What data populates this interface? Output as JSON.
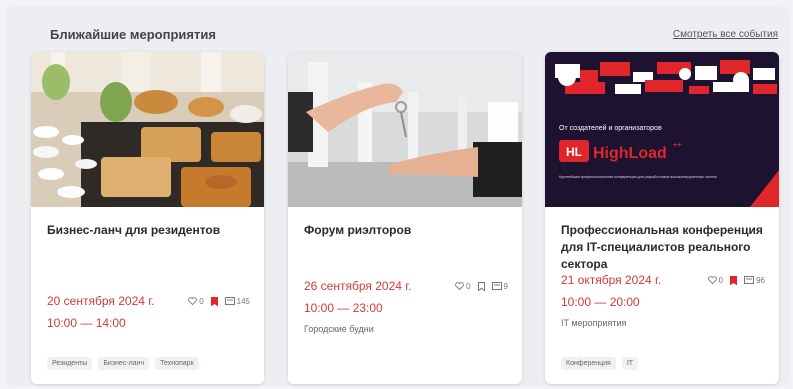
{
  "section": {
    "title": "Ближайшие мероприятия",
    "all_events_link": "Смотреть все события"
  },
  "banner": {
    "caption": "От создателей и организаторов",
    "logo_abbr": "HL",
    "logo_name": "HighLoad",
    "logo_sup": "++",
    "subcaption": "Крупнейшая профессиональная конференция для разработчиков высоконагруженных систем"
  },
  "events": [
    {
      "title": "Бизнес-ланч для резидентов",
      "date": "20 сентября 2024 г.",
      "time": "10:00 — 14:00",
      "category": "",
      "likes": "0",
      "bookmarked": true,
      "views": "145",
      "tags": [
        "Резиденты",
        "Бизнес-ланч",
        "Технопарк"
      ]
    },
    {
      "title": "Форум риэлторов",
      "date": "26 сентября 2024 г.",
      "time": "10:00 — 23:00",
      "category": "Городские будни",
      "likes": "0",
      "bookmarked": false,
      "views": "9",
      "tags": []
    },
    {
      "title": "Профессиональная конференция для IT-специалистов реального сектора",
      "date": "21 октября 2024 г.",
      "time": "10:00 — 20:00",
      "category": "IT мероприятия",
      "likes": "0",
      "bookmarked": true,
      "views": "96",
      "tags": [
        "Конференция",
        "IT"
      ]
    }
  ],
  "colors": {
    "accent_red": "#d33a3a",
    "bookmark_red": "#e0262b",
    "banner_bg": "#1d1230"
  }
}
